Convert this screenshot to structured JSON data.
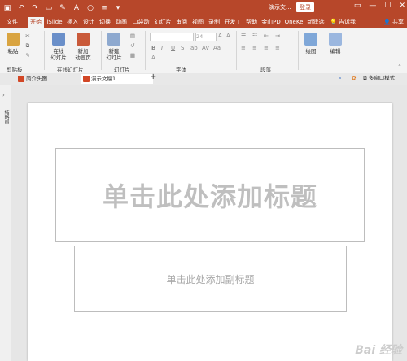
{
  "titlebar": {
    "doc_title": "演示文...",
    "login_label": "登录"
  },
  "tabs": [
    {
      "label": "文件"
    },
    {
      "label": "开始"
    },
    {
      "label": "iSlide"
    },
    {
      "label": "插入"
    },
    {
      "label": "设计"
    },
    {
      "label": "切换"
    },
    {
      "label": "动画"
    },
    {
      "label": "口袋动"
    },
    {
      "label": "幻灯片"
    },
    {
      "label": "审阅"
    },
    {
      "label": "视图"
    },
    {
      "label": "录制"
    },
    {
      "label": "开发工"
    },
    {
      "label": "帮助"
    },
    {
      "label": "金山PD"
    },
    {
      "label": "OneKe"
    },
    {
      "label": "新建选"
    }
  ],
  "tell_me": "告诉我",
  "share": "共享",
  "ribbon": {
    "paste": "粘贴",
    "clipboard": "剪贴板",
    "online_slides": "在线\n幻灯片",
    "new_animation": "新加\n动画页",
    "online_group": "在线幻灯片",
    "new_slide": "新建\n幻灯片",
    "slides_group": "幻灯片",
    "font_size": "24",
    "font_group": "字体",
    "paragraph_group": "段落",
    "drawing": "绘图",
    "editing": "编辑"
  },
  "doc_tabs": {
    "tab1": "简介头图",
    "tab2": "演示文稿1",
    "multi_window": "多窗口模式"
  },
  "left_panel_label": "缩略图",
  "slide": {
    "title_placeholder": "单击此处添加标题",
    "subtitle_placeholder": "单击此处添加副标题"
  },
  "watermark": "Bai 经验"
}
